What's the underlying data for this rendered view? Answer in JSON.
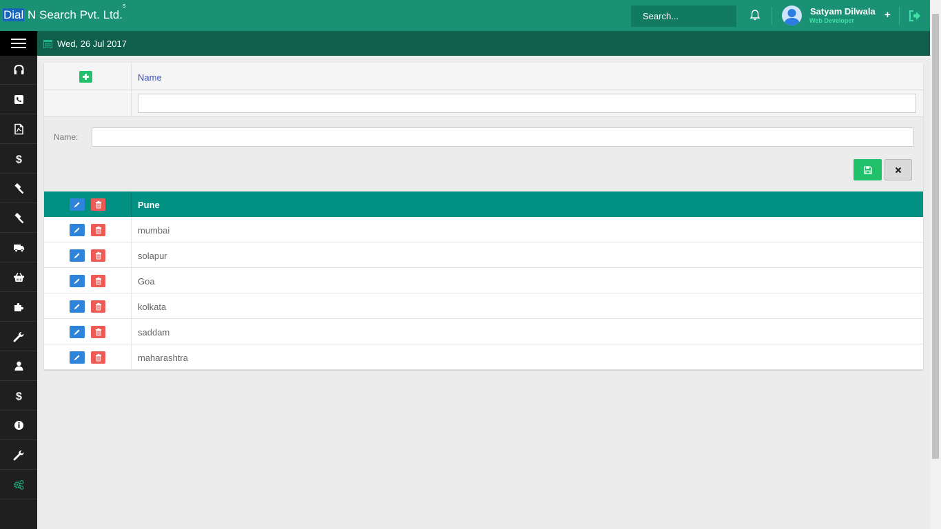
{
  "header": {
    "brand_highlight": "Dial",
    "brand_rest": " N Search Pvt. Ltd.",
    "brand_sup": "s",
    "search_placeholder": "Search...",
    "user_name": "Satyam Dilwala",
    "user_role": "Web Developer",
    "plus_label": "+"
  },
  "subheader": {
    "date": "Wed, 26 Jul 2017"
  },
  "sidebar": {
    "items": [
      {
        "icon": "headset-icon"
      },
      {
        "icon": "phone-icon"
      },
      {
        "icon": "pdf-file-icon"
      },
      {
        "icon": "dollar-icon"
      },
      {
        "icon": "gavel-icon"
      },
      {
        "icon": "gavel-icon"
      },
      {
        "icon": "truck-icon"
      },
      {
        "icon": "basket-icon"
      },
      {
        "icon": "puzzle-icon"
      },
      {
        "icon": "wrench-icon"
      },
      {
        "icon": "user-icon"
      },
      {
        "icon": "dollar-icon"
      },
      {
        "icon": "info-icon"
      },
      {
        "icon": "wrench-icon"
      },
      {
        "icon": "gears-icon"
      }
    ]
  },
  "grid": {
    "column_title": "Name",
    "filter_value": "",
    "form": {
      "name_label": "Name:",
      "name_value": ""
    },
    "rows": [
      {
        "name": "Pune",
        "selected": true
      },
      {
        "name": "mumbai",
        "selected": false
      },
      {
        "name": "solapur",
        "selected": false
      },
      {
        "name": "Goa",
        "selected": false
      },
      {
        "name": "kolkata",
        "selected": false
      },
      {
        "name": "saddam",
        "selected": false
      },
      {
        "name": "maharashtra",
        "selected": false
      }
    ]
  },
  "colors": {
    "header": "#1a9174",
    "subheader": "#0f5f4b",
    "selected_row": "#009182",
    "add_green": "#21c16c",
    "edit_blue": "#2e84da",
    "delete_red": "#ee5b57"
  }
}
